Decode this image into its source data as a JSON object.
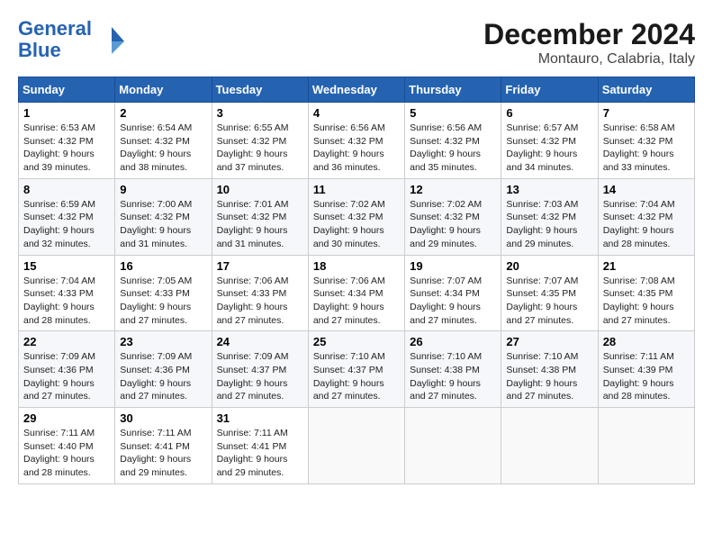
{
  "header": {
    "logo_line1": "General",
    "logo_line2": "Blue",
    "month": "December 2024",
    "location": "Montauro, Calabria, Italy"
  },
  "days_of_week": [
    "Sunday",
    "Monday",
    "Tuesday",
    "Wednesday",
    "Thursday",
    "Friday",
    "Saturday"
  ],
  "weeks": [
    [
      {
        "day": "1",
        "sunrise": "6:53 AM",
        "sunset": "4:32 PM",
        "daylight": "9 hours and 39 minutes."
      },
      {
        "day": "2",
        "sunrise": "6:54 AM",
        "sunset": "4:32 PM",
        "daylight": "9 hours and 38 minutes."
      },
      {
        "day": "3",
        "sunrise": "6:55 AM",
        "sunset": "4:32 PM",
        "daylight": "9 hours and 37 minutes."
      },
      {
        "day": "4",
        "sunrise": "6:56 AM",
        "sunset": "4:32 PM",
        "daylight": "9 hours and 36 minutes."
      },
      {
        "day": "5",
        "sunrise": "6:56 AM",
        "sunset": "4:32 PM",
        "daylight": "9 hours and 35 minutes."
      },
      {
        "day": "6",
        "sunrise": "6:57 AM",
        "sunset": "4:32 PM",
        "daylight": "9 hours and 34 minutes."
      },
      {
        "day": "7",
        "sunrise": "6:58 AM",
        "sunset": "4:32 PM",
        "daylight": "9 hours and 33 minutes."
      }
    ],
    [
      {
        "day": "8",
        "sunrise": "6:59 AM",
        "sunset": "4:32 PM",
        "daylight": "9 hours and 32 minutes."
      },
      {
        "day": "9",
        "sunrise": "7:00 AM",
        "sunset": "4:32 PM",
        "daylight": "9 hours and 31 minutes."
      },
      {
        "day": "10",
        "sunrise": "7:01 AM",
        "sunset": "4:32 PM",
        "daylight": "9 hours and 31 minutes."
      },
      {
        "day": "11",
        "sunrise": "7:02 AM",
        "sunset": "4:32 PM",
        "daylight": "9 hours and 30 minutes."
      },
      {
        "day": "12",
        "sunrise": "7:02 AM",
        "sunset": "4:32 PM",
        "daylight": "9 hours and 29 minutes."
      },
      {
        "day": "13",
        "sunrise": "7:03 AM",
        "sunset": "4:32 PM",
        "daylight": "9 hours and 29 minutes."
      },
      {
        "day": "14",
        "sunrise": "7:04 AM",
        "sunset": "4:32 PM",
        "daylight": "9 hours and 28 minutes."
      }
    ],
    [
      {
        "day": "15",
        "sunrise": "7:04 AM",
        "sunset": "4:33 PM",
        "daylight": "9 hours and 28 minutes."
      },
      {
        "day": "16",
        "sunrise": "7:05 AM",
        "sunset": "4:33 PM",
        "daylight": "9 hours and 27 minutes."
      },
      {
        "day": "17",
        "sunrise": "7:06 AM",
        "sunset": "4:33 PM",
        "daylight": "9 hours and 27 minutes."
      },
      {
        "day": "18",
        "sunrise": "7:06 AM",
        "sunset": "4:34 PM",
        "daylight": "9 hours and 27 minutes."
      },
      {
        "day": "19",
        "sunrise": "7:07 AM",
        "sunset": "4:34 PM",
        "daylight": "9 hours and 27 minutes."
      },
      {
        "day": "20",
        "sunrise": "7:07 AM",
        "sunset": "4:35 PM",
        "daylight": "9 hours and 27 minutes."
      },
      {
        "day": "21",
        "sunrise": "7:08 AM",
        "sunset": "4:35 PM",
        "daylight": "9 hours and 27 minutes."
      }
    ],
    [
      {
        "day": "22",
        "sunrise": "7:09 AM",
        "sunset": "4:36 PM",
        "daylight": "9 hours and 27 minutes."
      },
      {
        "day": "23",
        "sunrise": "7:09 AM",
        "sunset": "4:36 PM",
        "daylight": "9 hours and 27 minutes."
      },
      {
        "day": "24",
        "sunrise": "7:09 AM",
        "sunset": "4:37 PM",
        "daylight": "9 hours and 27 minutes."
      },
      {
        "day": "25",
        "sunrise": "7:10 AM",
        "sunset": "4:37 PM",
        "daylight": "9 hours and 27 minutes."
      },
      {
        "day": "26",
        "sunrise": "7:10 AM",
        "sunset": "4:38 PM",
        "daylight": "9 hours and 27 minutes."
      },
      {
        "day": "27",
        "sunrise": "7:10 AM",
        "sunset": "4:38 PM",
        "daylight": "9 hours and 27 minutes."
      },
      {
        "day": "28",
        "sunrise": "7:11 AM",
        "sunset": "4:39 PM",
        "daylight": "9 hours and 28 minutes."
      }
    ],
    [
      {
        "day": "29",
        "sunrise": "7:11 AM",
        "sunset": "4:40 PM",
        "daylight": "9 hours and 28 minutes."
      },
      {
        "day": "30",
        "sunrise": "7:11 AM",
        "sunset": "4:41 PM",
        "daylight": "9 hours and 29 minutes."
      },
      {
        "day": "31",
        "sunrise": "7:11 AM",
        "sunset": "4:41 PM",
        "daylight": "9 hours and 29 minutes."
      },
      null,
      null,
      null,
      null
    ]
  ]
}
